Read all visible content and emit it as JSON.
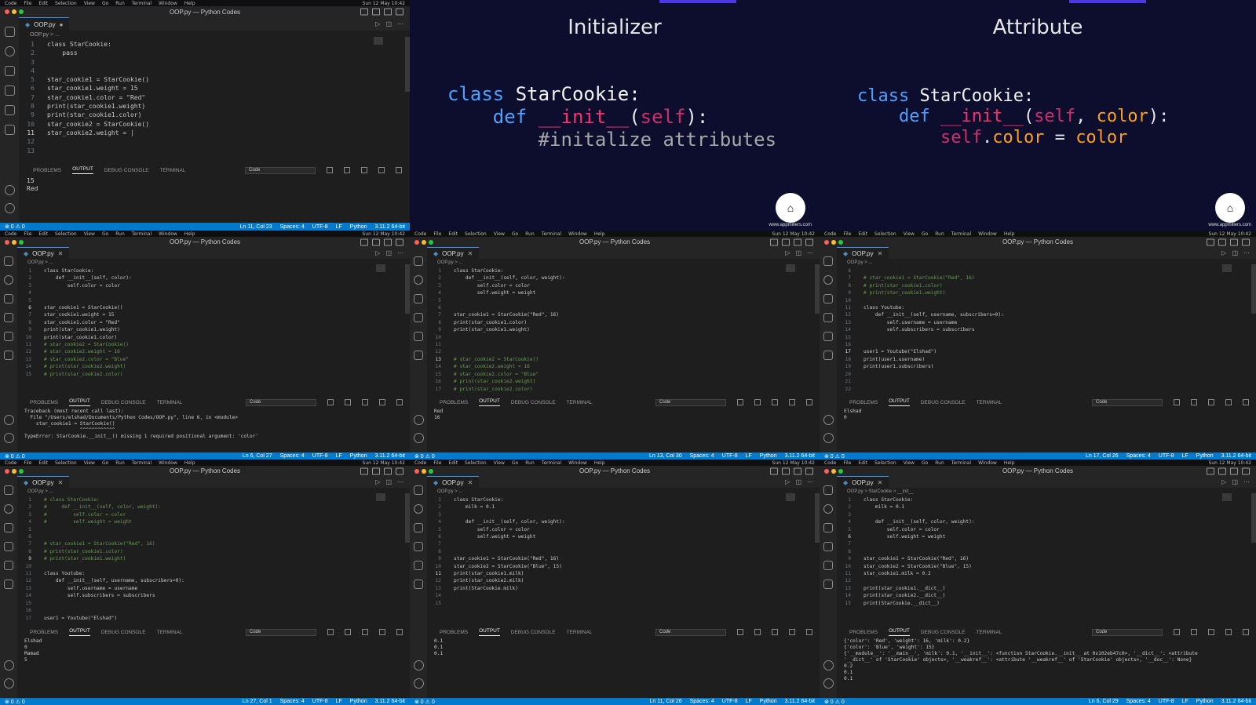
{
  "macmenu": [
    "Code",
    "File",
    "Edit",
    "Selection",
    "View",
    "Go",
    "Run",
    "Terminal",
    "Window",
    "Help"
  ],
  "clock": "Sun 12 May 10:42",
  "main": {
    "title": "OOP.py — Python Codes",
    "tab": "OOP.py",
    "breadcrumb": "OOP.py > ...",
    "code": [
      {
        "n": "1",
        "t": "class StarCookie:"
      },
      {
        "n": "2",
        "t": "    pass"
      },
      {
        "n": "3",
        "t": ""
      },
      {
        "n": "4",
        "t": ""
      },
      {
        "n": "5",
        "t": "star_cookie1 = StarCookie()"
      },
      {
        "n": "6",
        "t": "star_cookie1.weight = 15"
      },
      {
        "n": "7",
        "t": "star_cookie1.color = \"Red\""
      },
      {
        "n": "8",
        "t": "print(star_cookie1.weight)"
      },
      {
        "n": "9",
        "t": "print(star_cookie1.color)"
      },
      {
        "n": "10",
        "t": "star_cookie2 = StarCookie()"
      },
      {
        "n": "11",
        "t": "star_cookie2.weight = |"
      },
      {
        "n": "12",
        "t": ""
      },
      {
        "n": "13",
        "t": ""
      }
    ],
    "panel_tabs": [
      "PROBLEMS",
      "OUTPUT",
      "DEBUG CONSOLE",
      "TERMINAL"
    ],
    "output_select": "Code",
    "output": "15\nRed",
    "status_left": "⊗ 0 ⚠ 0",
    "status_right": [
      "Ln 11, Col 23",
      "Spaces: 4",
      "UTF-8",
      "LF",
      "Python",
      "3.11.2 64-bit"
    ]
  },
  "slides": [
    {
      "title": "Initializer",
      "code": [
        [
          {
            "c": "kw",
            "t": "class "
          },
          {
            "c": "cls",
            "t": "StarCookie:"
          }
        ],
        [
          {
            "c": "pl",
            "t": "    "
          },
          {
            "c": "kw",
            "t": "def "
          },
          {
            "c": "fn",
            "t": "__init__"
          },
          {
            "c": "pl",
            "t": "("
          },
          {
            "c": "sf",
            "t": "self"
          },
          {
            "c": "pl",
            "t": "):"
          }
        ],
        [
          {
            "c": "pl",
            "t": "        "
          },
          {
            "c": "cc",
            "t": "#initalize attributes"
          }
        ]
      ],
      "brand": "www.appmillers.com"
    },
    {
      "title": "Attribute",
      "code": [
        [
          {
            "c": "kw",
            "t": "class "
          },
          {
            "c": "cls",
            "t": "StarCookie:"
          }
        ],
        [
          {
            "c": "pl",
            "t": "    "
          },
          {
            "c": "kw",
            "t": "def "
          },
          {
            "c": "fn",
            "t": "__init__"
          },
          {
            "c": "pl",
            "t": "("
          },
          {
            "c": "sf",
            "t": "self"
          },
          {
            "c": "pl",
            "t": ", "
          },
          {
            "c": "at",
            "t": "color"
          },
          {
            "c": "pl",
            "t": "):"
          }
        ],
        [
          {
            "c": "pl",
            "t": "        "
          },
          {
            "c": "sf",
            "t": "self"
          },
          {
            "c": "pl",
            "t": "."
          },
          {
            "c": "at",
            "t": "color"
          },
          {
            "c": "pl",
            "t": " = "
          },
          {
            "c": "at",
            "t": "color"
          }
        ]
      ],
      "brand": "www.appmillers.com"
    }
  ],
  "mini": [
    {
      "title": "OOP.py — Python Codes",
      "tab": "OOP.py",
      "breadcrumb": "OOP.py > ...",
      "cur": "6",
      "code": [
        {
          "n": "1",
          "t": "class StarCookie:"
        },
        {
          "n": "2",
          "t": "    def __init__(self, color):"
        },
        {
          "n": "3",
          "t": "        self.color = color"
        },
        {
          "n": "4",
          "t": ""
        },
        {
          "n": "5",
          "t": ""
        },
        {
          "n": "6",
          "t": "star_cookie1 = StarCookie()"
        },
        {
          "n": "7",
          "t": "star_cookie1.weight = 15"
        },
        {
          "n": "8",
          "t": "star_cookie1.color = \"Red\""
        },
        {
          "n": "9",
          "t": "print(star_cookie1.weight)"
        },
        {
          "n": "10",
          "t": "print(star_cookie1.color)"
        },
        {
          "n": "11",
          "t": "# star_cookie2 = StarCookie()"
        },
        {
          "n": "12",
          "t": "# star_cookie2.weight = 16"
        },
        {
          "n": "13",
          "t": "# star_cookie2.color = \"Blue\""
        },
        {
          "n": "14",
          "t": "# print(star_cookie2.weight)"
        },
        {
          "n": "15",
          "t": "# print(star_cookie2.color)"
        }
      ],
      "output": "Traceback (most recent call last):\n  File \"/Users/elshad/Documents/Python Codes/OOP.py\", line 6, in <module>\n    star_cookie1 = StarCookie()\n                   ^^^^^^^^^^^^\nTypeError: StarCookie.__init__() missing 1 required positional argument: 'color'",
      "status": "Ln 6, Col 27"
    },
    {
      "title": "OOP.py — Python Codes",
      "tab": "OOP.py",
      "breadcrumb": "OOP.py > ...",
      "cur": "13",
      "code": [
        {
          "n": "1",
          "t": "class StarCookie:"
        },
        {
          "n": "2",
          "t": "    def __init__(self, color, weight):"
        },
        {
          "n": "3",
          "t": "        self.color = color"
        },
        {
          "n": "4",
          "t": "        self.weight = weight"
        },
        {
          "n": "5",
          "t": ""
        },
        {
          "n": "6",
          "t": ""
        },
        {
          "n": "7",
          "t": "star_cookie1 = StarCookie(\"Red\", 16)"
        },
        {
          "n": "8",
          "t": "print(star_cookie1.color)"
        },
        {
          "n": "9",
          "t": "print(star_cookie1.weight)"
        },
        {
          "n": "10",
          "t": ""
        },
        {
          "n": "11",
          "t": ""
        },
        {
          "n": "12",
          "t": ""
        },
        {
          "n": "13",
          "t": "# star_cookie2 = StarCookie()"
        },
        {
          "n": "14",
          "t": "# star_cookie2.weight = 16"
        },
        {
          "n": "15",
          "t": "# star_cookie2.color = \"Blue\""
        },
        {
          "n": "16",
          "t": "# print(star_cookie2.weight)"
        },
        {
          "n": "17",
          "t": "# print(star_cookie2.color)"
        }
      ],
      "output": "Red\n16",
      "status": "Ln 13, Col 30"
    },
    {
      "title": "OOP.py — Python Codes",
      "tab": "OOP.py",
      "breadcrumb": "OOP.py > ...",
      "cur": "17",
      "code": [
        {
          "n": "6",
          "t": ""
        },
        {
          "n": "7",
          "t": "# star_cookie1 = StarCookie(\"Red\", 16)"
        },
        {
          "n": "8",
          "t": "# print(star_cookie1.color)"
        },
        {
          "n": "9",
          "t": "# print(star_cookie1.weight)"
        },
        {
          "n": "10",
          "t": ""
        },
        {
          "n": "11",
          "t": "class Youtube:"
        },
        {
          "n": "12",
          "t": "    def __init__(self, username, subscribers=0):"
        },
        {
          "n": "13",
          "t": "        self.username = username"
        },
        {
          "n": "14",
          "t": "        self.subscribers = subscribers"
        },
        {
          "n": "15",
          "t": ""
        },
        {
          "n": "16",
          "t": ""
        },
        {
          "n": "17",
          "t": "user1 = Youtube(\"Elshad\")"
        },
        {
          "n": "18",
          "t": "print(user1.username)"
        },
        {
          "n": "19",
          "t": "print(user1.subscribers)"
        },
        {
          "n": "20",
          "t": ""
        },
        {
          "n": "21",
          "t": ""
        },
        {
          "n": "22",
          "t": ""
        }
      ],
      "output": "Elshad\n0",
      "status": "Ln 17, Col 26"
    },
    {
      "title": "OOP.py — Python Codes",
      "tab": "OOP.py",
      "breadcrumb": "OOP.py > ...",
      "cur": "9",
      "code": [
        {
          "n": "1",
          "t": "# class StarCookie:"
        },
        {
          "n": "2",
          "t": "#     def __init__(self, color, weight):"
        },
        {
          "n": "3",
          "t": "#         self.color = color"
        },
        {
          "n": "4",
          "t": "#         self.weight = weight"
        },
        {
          "n": "5",
          "t": ""
        },
        {
          "n": "6",
          "t": ""
        },
        {
          "n": "7",
          "t": "# star_cookie1 = StarCookie(\"Red\", 16)"
        },
        {
          "n": "8",
          "t": "# print(star_cookie1.color)"
        },
        {
          "n": "9",
          "t": "# print(star_cookie1.weight)"
        },
        {
          "n": "10",
          "t": ""
        },
        {
          "n": "11",
          "t": "class Youtube:"
        },
        {
          "n": "12",
          "t": "    def __init__(self, username, subscribers=0):"
        },
        {
          "n": "13",
          "t": "        self.username = username"
        },
        {
          "n": "14",
          "t": "        self.subscribers = subscribers"
        },
        {
          "n": "15",
          "t": ""
        },
        {
          "n": "16",
          "t": ""
        },
        {
          "n": "17",
          "t": "user1 = Youtube(\"Elshad\")"
        }
      ],
      "output": "Elshad\n0\nMamad\n5",
      "status": "Ln 27, Col 1"
    },
    {
      "title": "OOP.py — Python Codes",
      "tab": "OOP.py",
      "breadcrumb": "OOP.py > ...",
      "cur": "11",
      "code": [
        {
          "n": "1",
          "t": "class StarCookie:"
        },
        {
          "n": "2",
          "t": "    milk = 0.1"
        },
        {
          "n": "3",
          "t": ""
        },
        {
          "n": "4",
          "t": "    def __init__(self, color, weight):"
        },
        {
          "n": "5",
          "t": "        self.color = color"
        },
        {
          "n": "6",
          "t": "        self.weight = weight"
        },
        {
          "n": "7",
          "t": ""
        },
        {
          "n": "8",
          "t": ""
        },
        {
          "n": "9",
          "t": "star_cookie1 = StarCookie(\"Red\", 16)"
        },
        {
          "n": "10",
          "t": "star_cookie2 = StarCookie(\"Blue\", 15)"
        },
        {
          "n": "11",
          "t": "print(star_cookie1.milk)"
        },
        {
          "n": "12",
          "t": "print(star_cookie2.milk)"
        },
        {
          "n": "13",
          "t": "print(StarCookie.milk)"
        },
        {
          "n": "14",
          "t": ""
        },
        {
          "n": "15",
          "t": ""
        }
      ],
      "output": "0.1\n0.1\n0.1",
      "status": "Ln 11, Col 26"
    },
    {
      "title": "OOP.py — Python Codes",
      "tab": "OOP.py",
      "breadcrumb": "OOP.py > StarCookie > __init__",
      "cur": "6",
      "code": [
        {
          "n": "1",
          "t": "class StarCookie:"
        },
        {
          "n": "2",
          "t": "    milk = 0.1"
        },
        {
          "n": "3",
          "t": ""
        },
        {
          "n": "4",
          "t": "    def __init__(self, color, weight):"
        },
        {
          "n": "5",
          "t": "        self.color = color"
        },
        {
          "n": "6",
          "t": "        self.weight = weight"
        },
        {
          "n": "7",
          "t": ""
        },
        {
          "n": "8",
          "t": ""
        },
        {
          "n": "9",
          "t": "star_cookie1 = StarCookie(\"Red\", 16)"
        },
        {
          "n": "10",
          "t": "star_cookie2 = StarCookie(\"Blue\", 15)"
        },
        {
          "n": "11",
          "t": "star_cookie1.milk = 0.2"
        },
        {
          "n": "12",
          "t": ""
        },
        {
          "n": "13",
          "t": "print(star_cookie1.__dict__)"
        },
        {
          "n": "14",
          "t": "print(star_cookie2.__dict__)"
        },
        {
          "n": "15",
          "t": "print(StarCookie.__dict__)"
        }
      ],
      "output": "{'color': 'Red', 'weight': 16, 'milk': 0.2}\n{'color': 'Blue', 'weight': 15}\n{'__module__': '__main__', 'milk': 0.1, '__init__': <function StarCookie.__init__ at 0x102eb47c0>, '__dict__': <attribute\n'__dict__' of 'StarCookie' objects>, '__weakref__': <attribute '__weakref__' of 'StarCookie' objects>, '__doc__': None}\n0.2\n0.1\n0.1",
      "status": "Ln 6, Col 29"
    }
  ],
  "mini_status_right": [
    "Spaces: 4",
    "UTF-8",
    "LF",
    "Python",
    "3.11.2 64-bit"
  ]
}
